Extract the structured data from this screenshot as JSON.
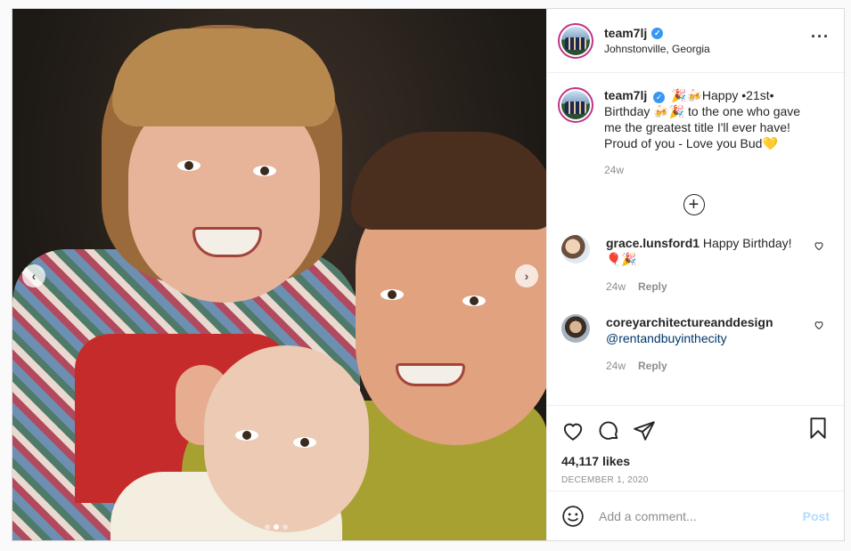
{
  "post": {
    "username": "team7lj",
    "location": "Johnstonville, Georgia",
    "more_icon": "more-horizontal-icon",
    "caption": {
      "username": "team7lj",
      "text": "🎉🍻Happy •21st• Birthday 🍻🎉 to the one who gave me the greatest title I'll ever have! Proud of you - Love you Bud💛",
      "time": "24w"
    },
    "load_more_icon": "plus-circle-icon",
    "comments": [
      {
        "username": "grace.lunsford1",
        "text": "Happy Birthday! 🎈🎉",
        "time": "24w",
        "reply": "Reply"
      },
      {
        "username": "coreyarchitectureanddesign",
        "text": "@rentandbuyinthecity",
        "time": "24w",
        "reply": "Reply"
      }
    ],
    "likes": "44,117 likes",
    "date": "DECEMBER 1, 2020",
    "comment_placeholder": "Add a comment...",
    "post_button": "Post",
    "carousel": {
      "total_slides": 3,
      "active_slide": 2
    }
  },
  "colors": {
    "verified": "#3897f0",
    "link": "#00376b",
    "post_disabled": "#b3dbff",
    "story_ring": "#c13584"
  }
}
